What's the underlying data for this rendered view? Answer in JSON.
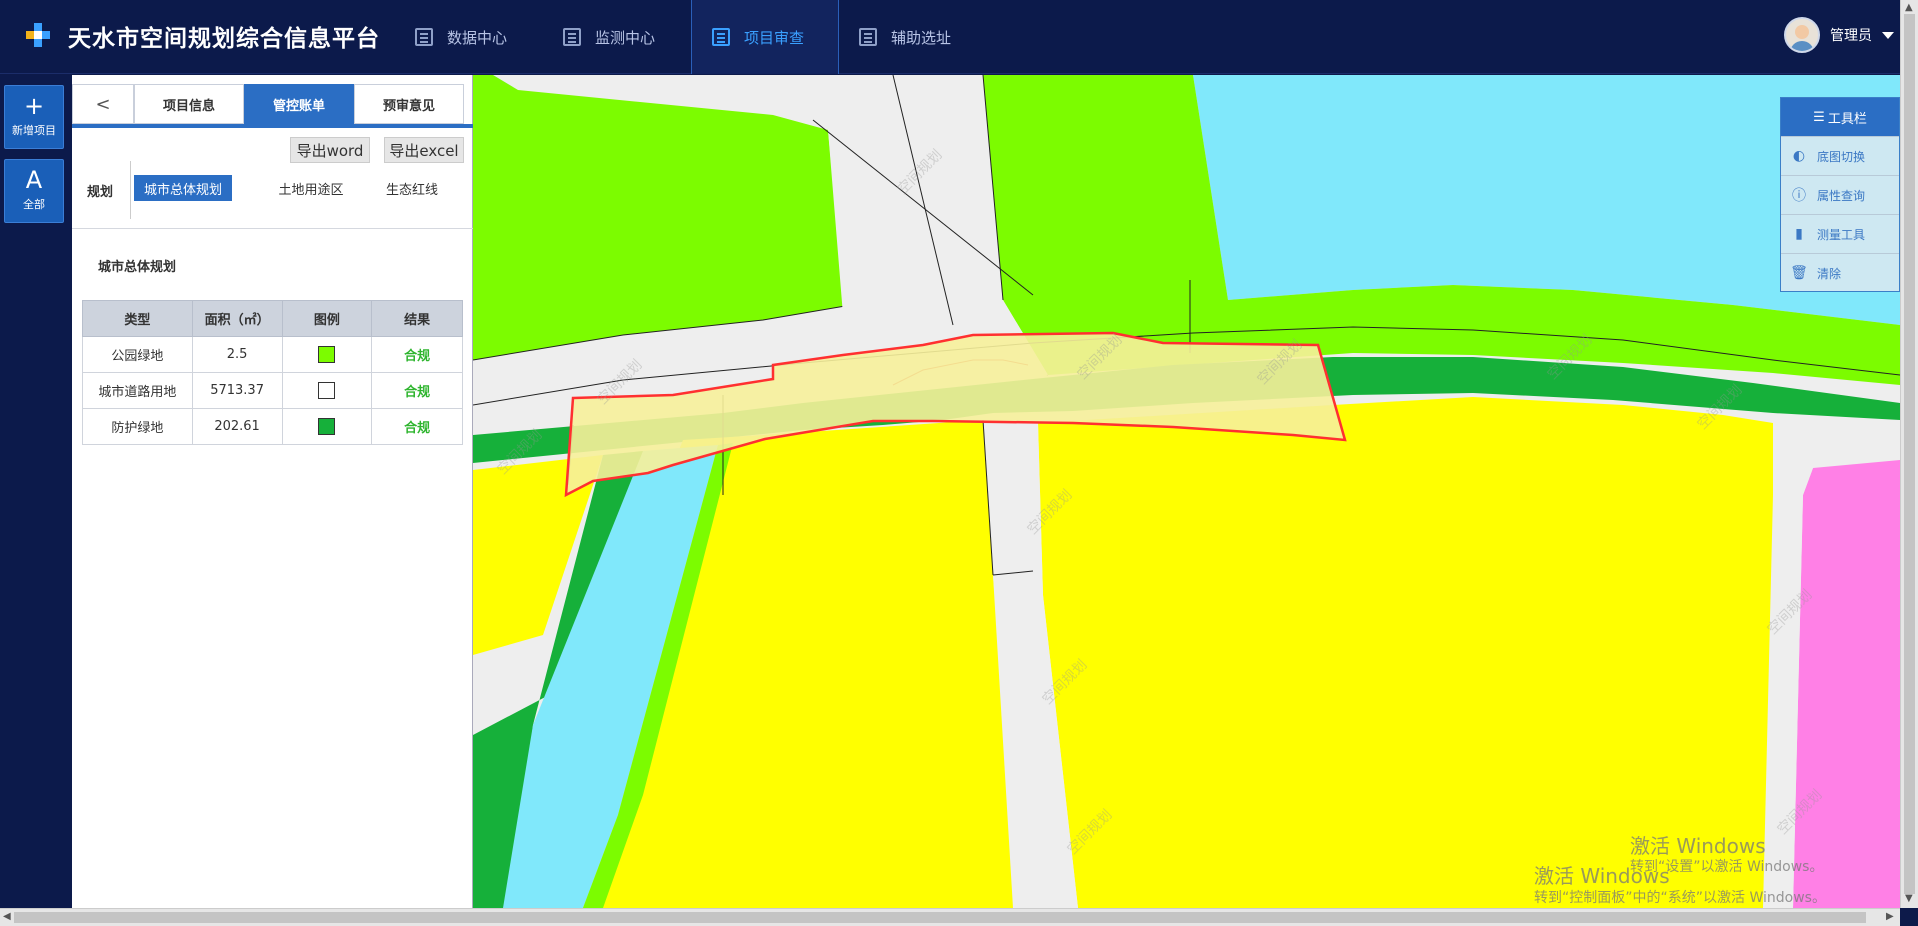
{
  "header": {
    "title": "天水市空间规划综合信息平台",
    "nav": [
      {
        "label": "数据中心",
        "active": false
      },
      {
        "label": "监测中心",
        "active": false
      },
      {
        "label": "项目审查",
        "active": true
      },
      {
        "label": "辅助选址",
        "active": false
      }
    ],
    "user_name": "管理员"
  },
  "rail": {
    "new_project_symbol": "+",
    "new_project_label": "新增项目",
    "all_symbol": "A",
    "all_label": "全部"
  },
  "panel": {
    "back_symbol": "<",
    "tabs": [
      "项目信息",
      "管控账单",
      "预审意见"
    ],
    "active_tab": "管控账单",
    "export_word": "导出word",
    "export_excel": "导出excel",
    "category_label": "规划",
    "subtabs": [
      "城市总体规划",
      "土地用途区",
      "生态红线"
    ],
    "active_subtab": "城市总体规划",
    "section_title": "城市总体规划",
    "table": {
      "headers": [
        "类型",
        "面积（㎡）",
        "图例",
        "结果"
      ],
      "rows": [
        {
          "type": "公园绿地",
          "area": "2.5",
          "legend_color": "#7cfc00",
          "result": "合规"
        },
        {
          "type": "城市道路用地",
          "area": "5713.37",
          "legend_color": "#ffffff",
          "result": "合规"
        },
        {
          "type": "防护绿地",
          "area": "202.61",
          "legend_color": "#16b03a",
          "result": "合规"
        }
      ]
    }
  },
  "toolbar": {
    "title": "工具栏",
    "items": [
      {
        "label": "底图切换",
        "icon": "half-circle-icon"
      },
      {
        "label": "属性查询",
        "icon": "info-icon"
      },
      {
        "label": "测量工具",
        "icon": "ruler-icon"
      },
      {
        "label": "清除",
        "icon": "trash-icon"
      }
    ]
  },
  "map": {
    "map_watermark": "空间规划",
    "colors": {
      "water": "#80e8fb",
      "park_green": "#7cfc00",
      "protective_green": "#16b03a",
      "residential": "#ffff00",
      "commercial": "#ff80e6",
      "road": "#eeeeee",
      "highlight_fill": "#f6f09a",
      "highlight_stroke": "#ff3030"
    }
  },
  "os_watermark": {
    "title": "激活 Windows",
    "line1": "转到“设置”以激活 Windows。",
    "line2": "转到“控制面板”中的“系统”以激活 Windows。"
  }
}
